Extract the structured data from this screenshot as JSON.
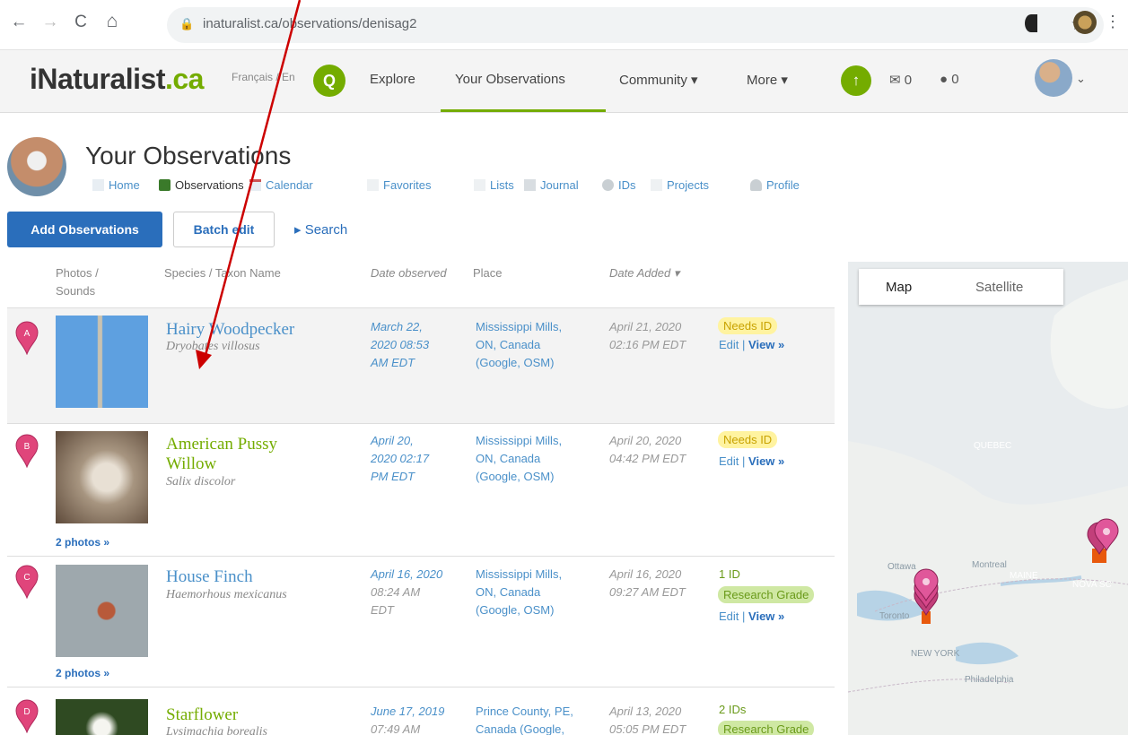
{
  "browser": {
    "url": "inaturalist.ca/observations/denisag2",
    "back": "←",
    "forward": "→",
    "reload": "C",
    "home": "⌂"
  },
  "header": {
    "logo_main": "iNaturalist",
    "logo_ca": ".ca",
    "lang": "Français / En",
    "nav": [
      "Explore",
      "Your Observations",
      "Community ▾",
      "More ▾"
    ],
    "messages": "0",
    "comments": "0",
    "accent": "#74ac00"
  },
  "page": {
    "title": "Your Observations",
    "subnav": [
      "Home",
      "Observations",
      "Calendar",
      "Favorites",
      "Lists",
      "Journal",
      "IDs",
      "Projects",
      "Profile"
    ],
    "add_button": "Add Observations",
    "batch_button": "Batch edit",
    "search_link": "▸ Search"
  },
  "table": {
    "headers": {
      "photos": "Photos /",
      "photos2": "Sounds",
      "species": "Species / Taxon Name",
      "date": "Date observed",
      "place": "Place",
      "added": "Date Added ▾"
    },
    "rows": [
      {
        "pin": "A",
        "common": "Hairy Woodpecker",
        "sci": "Dryobates villosus",
        "date": [
          "March 22,",
          "2020 08:53",
          "AM EDT"
        ],
        "place": [
          "Mississippi Mills,",
          "ON, Canada",
          "(Google, OSM)"
        ],
        "added": [
          "April 21, 2020",
          "02:16 PM EDT"
        ],
        "badge": "Needs ID",
        "edit": "Edit",
        "view": "View »"
      },
      {
        "pin": "B",
        "common": "American Pussy Willow",
        "sci": "Salix discolor",
        "date": [
          "April 20,",
          "2020 02:17",
          "PM EDT"
        ],
        "place": [
          "Mississippi Mills,",
          "ON, Canada",
          "(Google, OSM)"
        ],
        "added": [
          "April 20, 2020",
          "04:42 PM EDT"
        ],
        "badge": "Needs ID",
        "edit": "Edit",
        "view": "View »",
        "photos": "2 photos »"
      },
      {
        "pin": "C",
        "common": "House Finch",
        "sci": "Haemorhous mexicanus",
        "date": [
          "April 16, 2020",
          "08:24 AM",
          "EDT"
        ],
        "place": [
          "Mississippi Mills,",
          "ON, Canada",
          "(Google, OSM)"
        ],
        "added": [
          "April 16, 2020",
          "09:27 AM EDT"
        ],
        "ids": "1 ID",
        "badge": "Research Grade",
        "edit": "Edit",
        "view": "View »",
        "photos": "2 photos »"
      },
      {
        "pin": "D",
        "common": "Starflower",
        "sci": "Lysimachia borealis",
        "date": [
          "June 17, 2019",
          "07:49 AM"
        ],
        "place": [
          "Prince County, PE,",
          "Canada (Google,"
        ],
        "added": [
          "April 13, 2020",
          "05:05 PM EDT"
        ],
        "ids": "2 IDs",
        "badge": "Research Grade"
      }
    ]
  },
  "map": {
    "tab_map": "Map",
    "tab_satellite": "Satellite",
    "labels": [
      "Ottawa",
      "Montreal",
      "Toronto",
      "NEW YORK",
      "Philadelphia",
      "QUEBEC",
      "MAINE",
      "NOVA SC"
    ]
  }
}
